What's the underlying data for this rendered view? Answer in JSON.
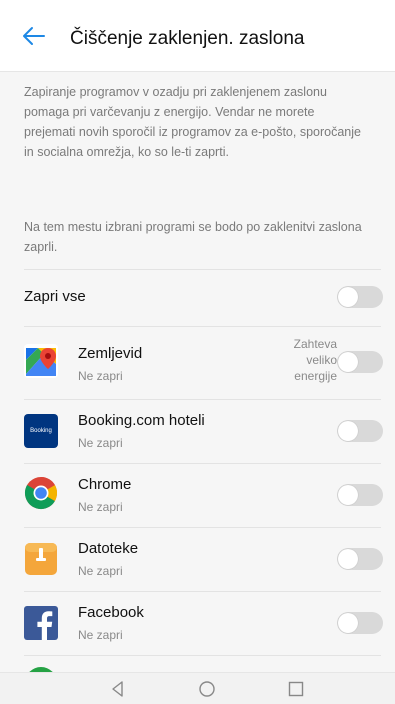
{
  "header": {
    "title": "Čiščenje zaklenjen. zaslona"
  },
  "description": {
    "paragraph1": "Zapiranje programov v ozadju pri zaklenjenem zaslonu pomaga pri varčevanju z energijo. Vendar ne morete prejemati novih sporočil iz programov za e-pošto, sporočanje in socialna omrežja, ko so le-ti zaprti.",
    "paragraph2": "Na tem mestu izbrani programi se bodo po zaklenitvi zaslona zaprli."
  },
  "close_all": {
    "label": "Zapri vse",
    "enabled": false
  },
  "apps": [
    {
      "name": "Zemljevid",
      "status": "Ne zapri",
      "badge": [
        "Zahteva",
        "veliko",
        "energije"
      ],
      "enabled": false,
      "icon": "maps-icon"
    },
    {
      "name": "Booking.com hoteli",
      "status": "Ne zapri",
      "icon_text": "Booking",
      "enabled": false,
      "icon": "booking-icon"
    },
    {
      "name": "Chrome",
      "status": "Ne zapri",
      "enabled": false,
      "icon": "chrome-icon"
    },
    {
      "name": "Datoteke",
      "status": "Ne zapri",
      "enabled": false,
      "icon": "files-icon"
    },
    {
      "name": "Facebook",
      "status": "Ne zapri",
      "enabled": false,
      "icon": "facebook-icon"
    }
  ],
  "colors": {
    "accent": "#1e88e5",
    "toggle_off": "#d9d9d9",
    "list_bg": "#f6f6f6"
  }
}
